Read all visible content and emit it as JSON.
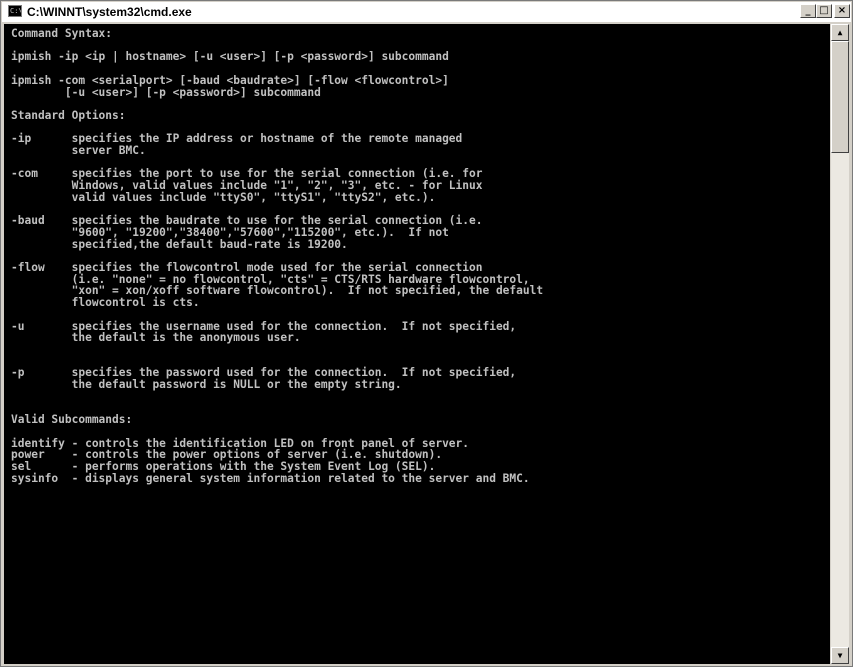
{
  "window": {
    "title": "C:\\WINNT\\system32\\cmd.exe",
    "icon_label": "C:\\",
    "minimize_glyph": "_",
    "maximize_glyph": "□",
    "close_glyph": "×"
  },
  "scrollbar": {
    "up_glyph": "▲",
    "down_glyph": "▼"
  },
  "console": {
    "text": "Command Syntax:\n\nipmish -ip <ip | hostname> [-u <user>] [-p <password>] subcommand\n\nipmish -com <serialport> [-baud <baudrate>] [-flow <flowcontrol>]\n        [-u <user>] [-p <password>] subcommand\n\nStandard Options:\n\n-ip      specifies the IP address or hostname of the remote managed\n         server BMC.\n\n-com     specifies the port to use for the serial connection (i.e. for\n         Windows, valid values include \"1\", \"2\", \"3\", etc. - for Linux\n         valid values include \"ttyS0\", \"ttyS1\", \"ttyS2\", etc.).\n\n-baud    specifies the baudrate to use for the serial connection (i.e.\n         \"9600\", \"19200\",\"38400\",\"57600\",\"115200\", etc.).  If not\n         specified,the default baud-rate is 19200.\n\n-flow    specifies the flowcontrol mode used for the serial connection\n         (i.e. \"none\" = no flowcontrol, \"cts\" = CTS/RTS hardware flowcontrol,\n         \"xon\" = xon/xoff software flowcontrol).  If not specified, the default\n         flowcontrol is cts.\n\n-u       specifies the username used for the connection.  If not specified,\n         the default is the anonymous user.\n\n\n-p       specifies the password used for the connection.  If not specified,\n         the default password is NULL or the empty string.\n\n\nValid Subcommands:\n\nidentify - controls the identification LED on front panel of server.\npower    - controls the power options of server (i.e. shutdown).\nsel      - performs operations with the System Event Log (SEL).\nsysinfo  - displays general system information related to the server and BMC."
  }
}
